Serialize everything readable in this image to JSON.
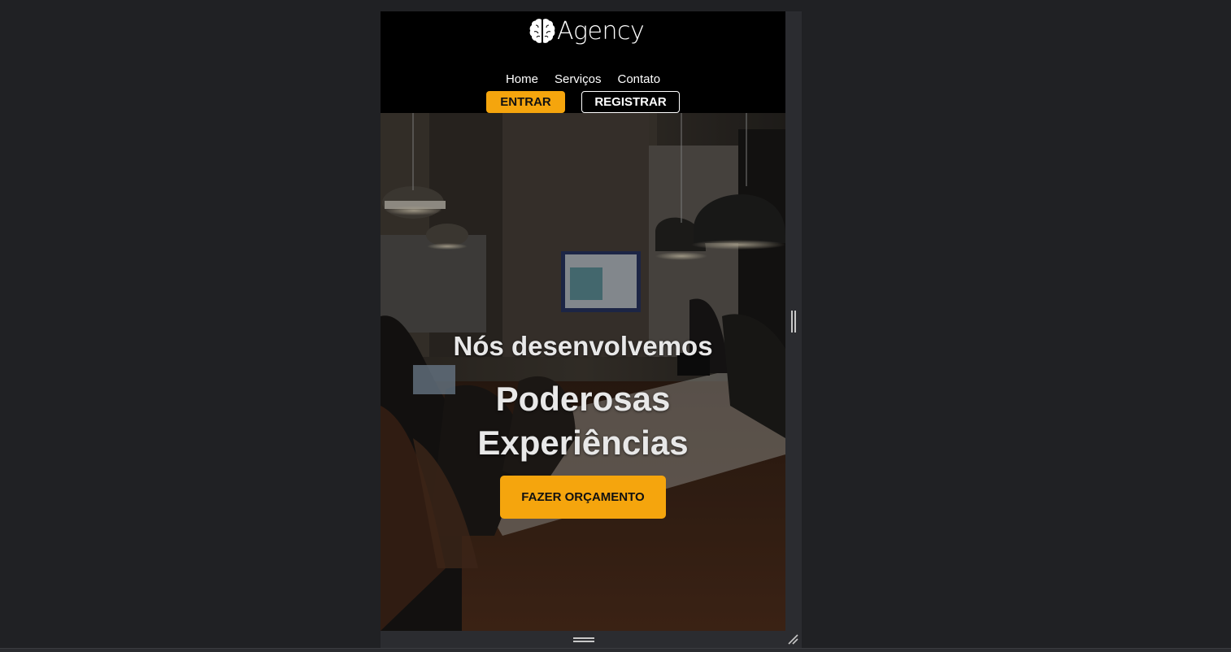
{
  "brand": {
    "name": "Agency",
    "icon": "brain-icon"
  },
  "nav": {
    "items": [
      {
        "label": "Home"
      },
      {
        "label": "Serviços"
      },
      {
        "label": "Contato"
      }
    ]
  },
  "auth": {
    "login_label": "ENTRAR",
    "register_label": "REGISTRAR"
  },
  "hero": {
    "subtitle": "Nós desenvolvemos",
    "title_line1": "Poderosas",
    "title_line2": "Experiências",
    "cta_label": "FAZER ORÇAMENTO"
  },
  "colors": {
    "accent": "#f5a50d",
    "header_bg": "#000000",
    "page_bg": "#202124"
  }
}
